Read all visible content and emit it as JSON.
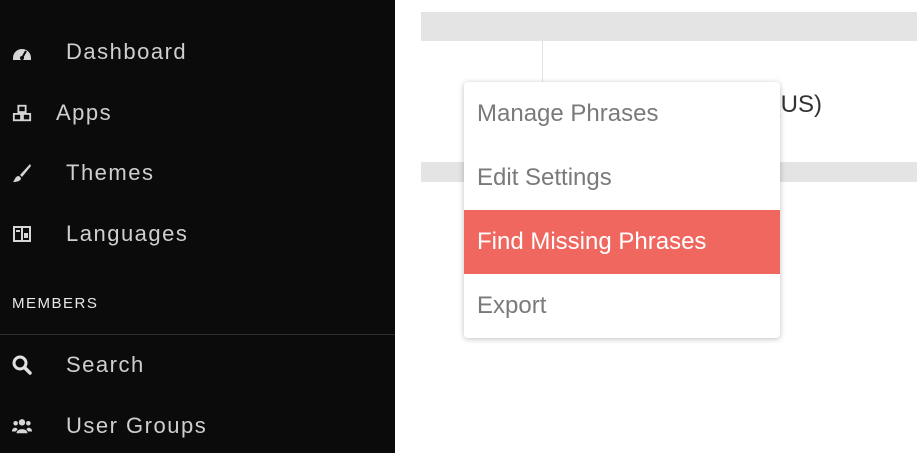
{
  "sidebar": {
    "items": [
      {
        "label": "Dashboard",
        "icon": "dashboard-icon"
      },
      {
        "label": "Apps",
        "icon": "cubes-icon"
      },
      {
        "label": "Themes",
        "icon": "brush-icon"
      },
      {
        "label": "Languages",
        "icon": "language-icon"
      }
    ],
    "section_header": "MEMBERS",
    "member_items": [
      {
        "label": "Search",
        "icon": "search-icon"
      },
      {
        "label": "User Groups",
        "icon": "users-icon"
      }
    ]
  },
  "main": {
    "language_value": "lish (US)"
  },
  "dropdown": {
    "items": [
      {
        "label": "Manage Phrases"
      },
      {
        "label": "Edit Settings"
      },
      {
        "label": "Find Missing Phrases"
      },
      {
        "label": "Export"
      }
    ],
    "active_color": "#f0675f"
  }
}
